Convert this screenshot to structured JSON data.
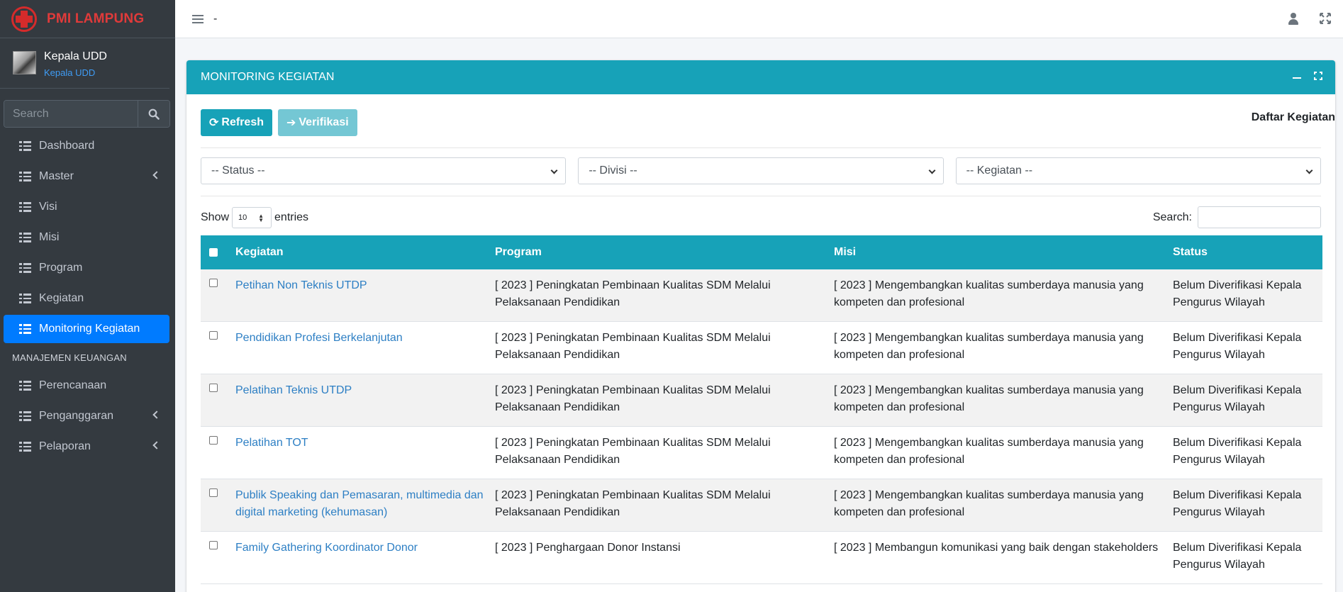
{
  "brand": {
    "name": "PMI LAMPUNG"
  },
  "user": {
    "name": "Kepala UDD",
    "role": "Kepala UDD"
  },
  "sidebar": {
    "search_placeholder": "Search",
    "items": [
      {
        "label": "Dashboard",
        "has_submenu": false,
        "active": false
      },
      {
        "label": "Master",
        "has_submenu": true,
        "active": false
      },
      {
        "label": "Visi",
        "has_submenu": false,
        "active": false
      },
      {
        "label": "Misi",
        "has_submenu": false,
        "active": false
      },
      {
        "label": "Program",
        "has_submenu": false,
        "active": false
      },
      {
        "label": "Kegiatan",
        "has_submenu": false,
        "active": false
      },
      {
        "label": "Monitoring Kegiatan",
        "has_submenu": false,
        "active": true
      }
    ],
    "section_header": "MANAJEMEN KEUANGAN",
    "finance_items": [
      {
        "label": "Perencanaan",
        "has_submenu": false
      },
      {
        "label": "Penganggaran",
        "has_submenu": true
      },
      {
        "label": "Pelaporan",
        "has_submenu": true
      }
    ]
  },
  "topbar": {
    "title": "-",
    "icons": [
      "menu-icon",
      "user-icon",
      "fullscreen-icon"
    ]
  },
  "card": {
    "title": "MONITORING KEGIATAN",
    "refresh_label": "Refresh",
    "verifikasi_label": "Verifikasi",
    "right_title": "Daftar Kegiatan",
    "filters": {
      "status": "-- Status --",
      "divisi": "-- Divisi --",
      "kegiatan": "-- Kegiatan --"
    },
    "show_label": "Show",
    "entries_value": "10",
    "entries_label": "entries",
    "search_label": "Search:",
    "columns": [
      "Kegiatan",
      "Program",
      "Misi",
      "Status"
    ],
    "rows": [
      {
        "kegiatan": "Petihan Non Teknis UTDP",
        "program": "[ 2023 ] Peningkatan Pembinaan Kualitas SDM Melalui Pelaksanaan Pendidikan",
        "misi": "[ 2023 ] Mengembangkan kualitas sumberdaya manusia yang kompeten dan profesional",
        "status": "Belum Diverifikasi Kepala Pengurus Wilayah"
      },
      {
        "kegiatan": "Pendidikan Profesi Berkelanjutan",
        "program": "[ 2023 ] Peningkatan Pembinaan Kualitas SDM Melalui Pelaksanaan Pendidikan",
        "misi": "[ 2023 ] Mengembangkan kualitas sumberdaya manusia yang kompeten dan profesional",
        "status": "Belum Diverifikasi Kepala Pengurus Wilayah"
      },
      {
        "kegiatan": "Pelatihan Teknis UTDP",
        "program": "[ 2023 ] Peningkatan Pembinaan Kualitas SDM Melalui Pelaksanaan Pendidikan",
        "misi": "[ 2023 ] Mengembangkan kualitas sumberdaya manusia yang kompeten dan profesional",
        "status": "Belum Diverifikasi Kepala Pengurus Wilayah"
      },
      {
        "kegiatan": "Pelatihan TOT",
        "program": "[ 2023 ] Peningkatan Pembinaan Kualitas SDM Melalui Pelaksanaan Pendidikan",
        "misi": "[ 2023 ] Mengembangkan kualitas sumberdaya manusia yang kompeten dan profesional",
        "status": "Belum Diverifikasi Kepala Pengurus Wilayah"
      },
      {
        "kegiatan": "Publik Speaking dan Pemasaran, multimedia dan digital marketing (kehumasan)",
        "program": "[ 2023 ] Peningkatan Pembinaan Kualitas SDM Melalui Pelaksanaan Pendidikan",
        "misi": "[ 2023 ] Mengembangkan kualitas sumberdaya manusia yang kompeten dan profesional",
        "status": "Belum Diverifikasi Kepala Pengurus Wilayah"
      },
      {
        "kegiatan": "Family Gathering Koordinator Donor",
        "program": "[ 2023 ] Penghargaan Donor Instansi",
        "misi": "[ 2023 ] Membangun komunikasi yang baik dengan stakeholders",
        "status": "Belum Diverifikasi Kepala Pengurus Wilayah"
      }
    ]
  },
  "colors": {
    "sidebar_bg": "#343a40",
    "accent_teal": "#17a2b8",
    "active_blue": "#007bff",
    "brand_red": "#e03a3a",
    "link": "#2d7fc4"
  }
}
